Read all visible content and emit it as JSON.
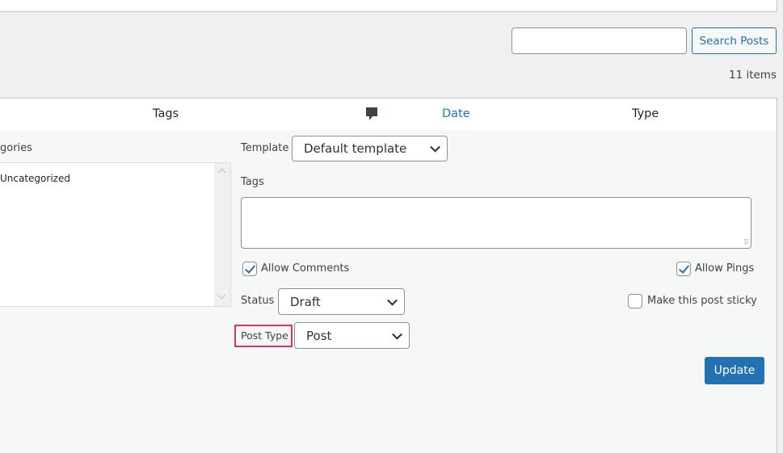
{
  "search": {
    "value": "",
    "button": "Search Posts"
  },
  "items_count": "11 items",
  "columns": {
    "tags": "Tags",
    "comments_icon": "comment-icon",
    "date": "Date",
    "type": "Type"
  },
  "edit": {
    "categories_label": "gories",
    "categories": [
      "Uncategorized"
    ],
    "template_label": "Template",
    "template_value": "Default template",
    "tags_label": "Tags",
    "tags_value": "",
    "allow_comments": "Allow Comments",
    "allow_comments_checked": true,
    "allow_pings": "Allow Pings",
    "allow_pings_checked": true,
    "status_label": "Status",
    "status_value": "Draft",
    "sticky": "Make this post sticky",
    "sticky_checked": false,
    "post_type_label": "Post Type",
    "post_type_value": "Post",
    "update": "Update"
  },
  "colors": {
    "accent": "#2271b1",
    "highlight": "#d63638"
  }
}
